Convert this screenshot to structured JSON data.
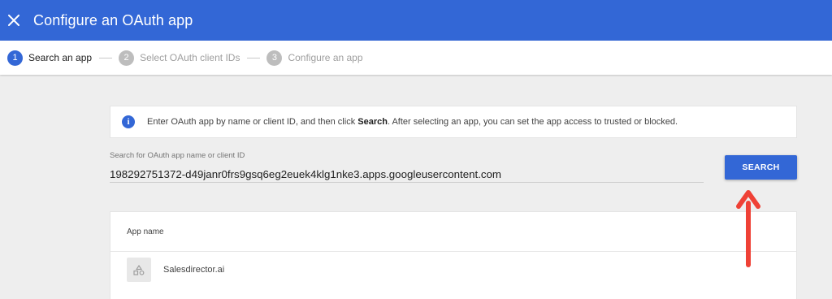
{
  "header": {
    "title": "Configure an OAuth app",
    "close_icon": "close-icon",
    "background": "#3367d6"
  },
  "stepper": {
    "steps": [
      {
        "number": "1",
        "label": "Search an app",
        "active": true
      },
      {
        "number": "2",
        "label": "Select OAuth client IDs",
        "active": false
      },
      {
        "number": "3",
        "label": "Configure an app",
        "active": false
      }
    ]
  },
  "info": {
    "icon": "info-icon",
    "text_before": "Enter OAuth app by name or client ID, and then click ",
    "text_bold": "Search",
    "text_after": ". After selecting an app, you can set the app access to trusted or blocked."
  },
  "search": {
    "label": "Search for OAuth app name or client ID",
    "value": "198292751372-d49janr0frs9gsq6eg2euek4klg1nke3.apps.googleusercontent.com",
    "button_label": "SEARCH"
  },
  "results": {
    "column_header": "App name",
    "rows": [
      {
        "app_name": "Salesdirector.ai",
        "icon": "app-placeholder-icon"
      }
    ]
  },
  "annotation": {
    "arrow_color": "#ef4136",
    "icon": "arrow-up-icon"
  }
}
